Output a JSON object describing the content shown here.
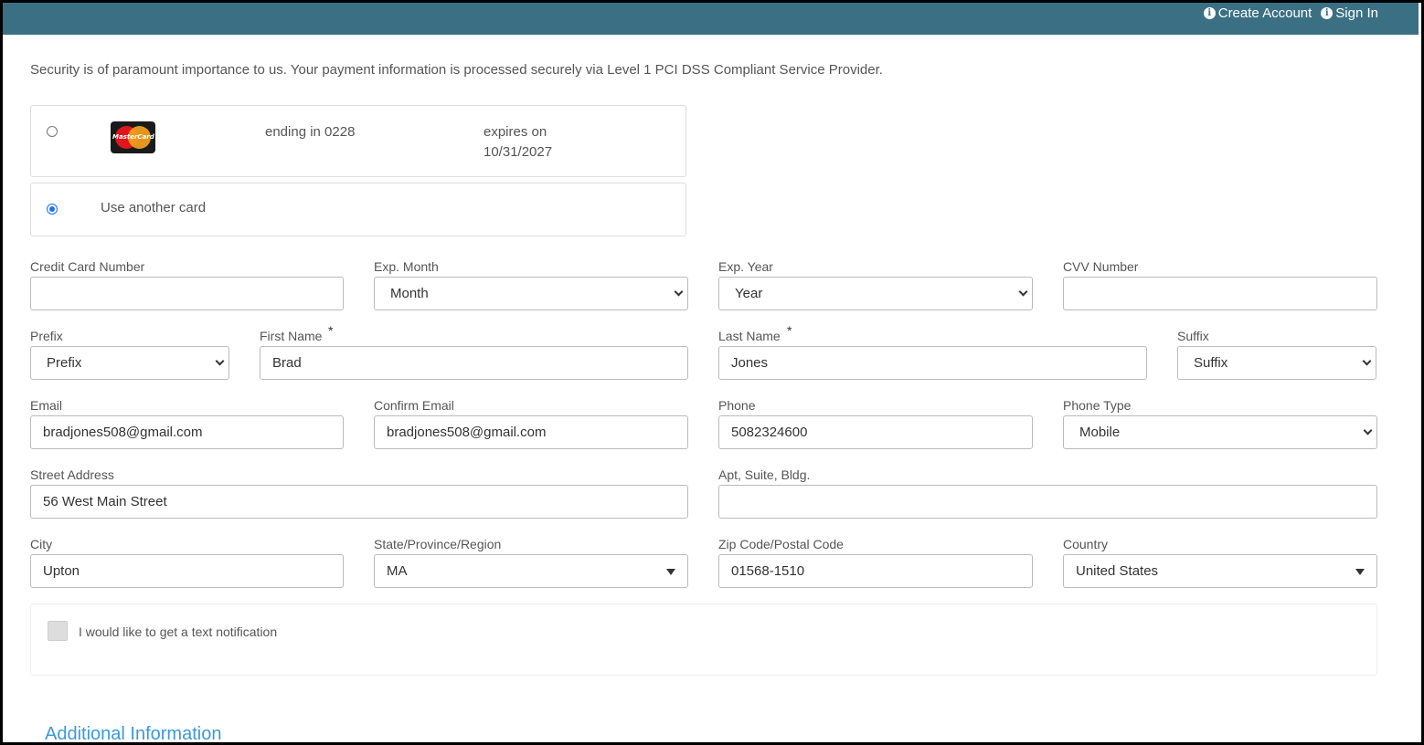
{
  "topnav": {
    "create_account": "Create Account",
    "sign_in": "Sign In"
  },
  "security_text": "Security is of paramount importance to us. Your payment information is processed securely via Level 1 PCI DSS Compliant Service Provider.",
  "saved_card": {
    "brand_label": "MasterCard",
    "ending": "ending in 0228",
    "expires_label": "expires on",
    "expires_date": "10/31/2027"
  },
  "another_card_label": "Use another card",
  "form": {
    "cc_number": {
      "label": "Credit Card Number",
      "value": ""
    },
    "exp_month": {
      "label": "Exp. Month",
      "value": "Month"
    },
    "exp_year": {
      "label": "Exp. Year",
      "value": "Year"
    },
    "cvv": {
      "label": "CVV Number",
      "value": ""
    },
    "prefix": {
      "label": "Prefix",
      "value": "Prefix"
    },
    "first_name": {
      "label": "First Name",
      "value": "Brad"
    },
    "last_name": {
      "label": "Last Name",
      "value": "Jones"
    },
    "suffix": {
      "label": "Suffix",
      "value": "Suffix"
    },
    "email": {
      "label": "Email",
      "value": "bradjones508@gmail.com"
    },
    "confirm_email": {
      "label": "Confirm Email",
      "value": "bradjones508@gmail.com"
    },
    "phone": {
      "label": "Phone",
      "value": "5082324600"
    },
    "phone_type": {
      "label": "Phone Type",
      "value": "Mobile"
    },
    "street": {
      "label": "Street Address",
      "value": "56 West Main Street"
    },
    "apt": {
      "label": "Apt, Suite, Bldg.",
      "value": ""
    },
    "city": {
      "label": "City",
      "value": "Upton"
    },
    "state": {
      "label": "State/Province/Region",
      "value": "MA"
    },
    "zip": {
      "label": "Zip Code/Postal Code",
      "value": "01568-1510"
    },
    "country": {
      "label": "Country",
      "value": "United States"
    },
    "required_mark": "*"
  },
  "notify_label": "I would like to get a text notification",
  "additional_heading": "Additional Information",
  "colors": {
    "topbar": "#3b7084",
    "accent_link": "#3b9ad9",
    "radio_selected": "#1a73e8"
  }
}
